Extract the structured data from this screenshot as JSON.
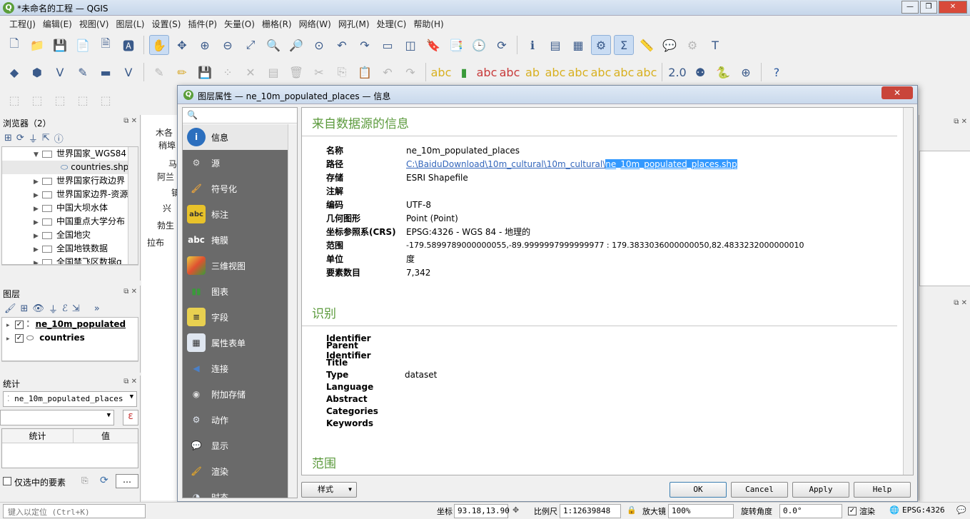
{
  "window": {
    "title": "*未命名的工程 — QGIS"
  },
  "menu": [
    "工程(J)",
    "编辑(E)",
    "视图(V)",
    "图层(L)",
    "设置(S)",
    "插件(P)",
    "矢量(O)",
    "栅格(R)",
    "网络(W)",
    "网孔(M)",
    "处理(C)",
    "帮助(H)"
  ],
  "browser": {
    "title": "浏览器（2）",
    "items": [
      {
        "label": "世界国家_WGS84",
        "expanded": true
      },
      {
        "label": "countries.shp",
        "child": true
      },
      {
        "label": "世界国家行政边界"
      },
      {
        "label": "世界国家边界-资源"
      },
      {
        "label": "中国大坝水体"
      },
      {
        "label": "中国重点大学分布"
      },
      {
        "label": "全国地灾"
      },
      {
        "label": "全国地铁数据"
      },
      {
        "label": "全国禁飞区数据g"
      }
    ]
  },
  "layers": {
    "title": "图层",
    "items": [
      {
        "label": "ne_10m_populated",
        "checked": true
      },
      {
        "label": "countries",
        "checked": true
      }
    ]
  },
  "stats": {
    "title": "统计",
    "layer": "ne_10m_populated_places",
    "col_stat": "统计",
    "col_value": "值",
    "only_selected": "仅选中的要素",
    "more": "…"
  },
  "map_fragments": [
    "木各",
    "稍埠",
    "马",
    "阿兰",
    "镇",
    "兴",
    "勃生",
    "拉布"
  ],
  "dialog": {
    "title": "图层属性 — ne_10m_populated_places — 信息",
    "close": "✕",
    "nav": [
      {
        "label": "信息",
        "icon": "i",
        "color": "#2c6fbe"
      },
      {
        "label": "源",
        "icon": "⚙",
        "color": "#8a8a8a"
      },
      {
        "label": "符号化",
        "icon": "🖌",
        "color": "#c89040"
      },
      {
        "label": "标注",
        "icon": "abc",
        "color": "#e8c22a"
      },
      {
        "label": "掩膜",
        "icon": "abc",
        "color": "#ffffff"
      },
      {
        "label": "三维视图",
        "icon": "■",
        "color": "#e0c040"
      },
      {
        "label": "图表",
        "icon": "▮",
        "color": "#3a9a3a"
      },
      {
        "label": "字段",
        "icon": "≡",
        "color": "#e8d050"
      },
      {
        "label": "属性表单",
        "icon": "▦",
        "color": "#dfe6f0"
      },
      {
        "label": "连接",
        "icon": "◀",
        "color": "#4a80c8"
      },
      {
        "label": "附加存储",
        "icon": "◉",
        "color": "#c8c8c8"
      },
      {
        "label": "动作",
        "icon": "⚙",
        "color": "#dfe6f0"
      },
      {
        "label": "显示",
        "icon": "▭",
        "color": "#f0d040"
      },
      {
        "label": "渲染",
        "icon": "🖌",
        "color": "#d8a030"
      },
      {
        "label": "时态",
        "icon": "◔",
        "color": "#dfe6f0"
      }
    ],
    "section_source": "来自数据源的信息",
    "source": [
      {
        "k": "名称",
        "v": "ne_10m_populated_places"
      },
      {
        "k": "路径",
        "v_link": "C:\\BaiduDownload\\10m_cultural\\10m_cultural\\",
        "v_hl": "ne_10m_populated_places.shp"
      },
      {
        "k": "存储",
        "v": "ESRI Shapefile"
      },
      {
        "k": "注解",
        "v": ""
      },
      {
        "k": "编码",
        "v": "UTF-8"
      },
      {
        "k": "几何图形",
        "v": "Point (Point)"
      },
      {
        "k": "坐标参照系(CRS)",
        "v": "EPSG:4326 - WGS 84 - 地理的"
      },
      {
        "k": "范围",
        "v": "-179.5899789000000055,-89.9999997999999977 : 179.3833036000000050,82.4833232000000010"
      },
      {
        "k": "单位",
        "v": "度"
      },
      {
        "k": "要素数目",
        "v": "7,342"
      }
    ],
    "section_ident": "识别",
    "ident": [
      {
        "k": "Identifier",
        "v": ""
      },
      {
        "k": "Parent Identifier",
        "v": ""
      },
      {
        "k": "Title",
        "v": ""
      },
      {
        "k": "Type",
        "v": "dataset"
      },
      {
        "k": "Language",
        "v": ""
      },
      {
        "k": "Abstract",
        "v": ""
      },
      {
        "k": "Categories",
        "v": ""
      },
      {
        "k": "Keywords",
        "v": ""
      }
    ],
    "section_extent": "范围",
    "style_btn": "样式",
    "ok": "OK",
    "cancel": "Cancel",
    "apply": "Apply",
    "help": "Help"
  },
  "status": {
    "locate_placeholder": "键入以定位 (Ctrl+K)",
    "coord_label": "坐标",
    "coord": "93.18,13.90",
    "scale_label": "比例尺",
    "scale": "1:12639848",
    "magnifier_label": "放大镜",
    "magnifier": "100%",
    "rotation_label": "旋转角度",
    "rotation": "0.0°",
    "render_label": "渲染",
    "crs": "EPSG:4326"
  }
}
